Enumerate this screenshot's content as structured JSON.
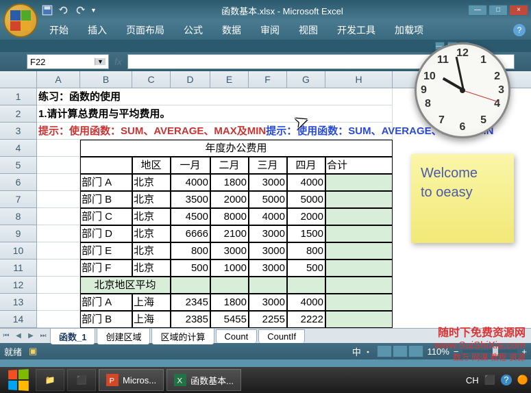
{
  "window": {
    "title": "函数基本.xlsx - Microsoft Excel",
    "controls": {
      "min": "—",
      "max": "□",
      "close": "×"
    }
  },
  "ribbon": {
    "tabs": [
      "开始",
      "插入",
      "页面布局",
      "公式",
      "数据",
      "审阅",
      "视图",
      "开发工具",
      "加载项"
    ],
    "help": "?"
  },
  "name_box": {
    "value": "F22",
    "fx": "fx"
  },
  "columns": [
    "A",
    "B",
    "C",
    "D",
    "E",
    "F",
    "G",
    "H"
  ],
  "rows": {
    "1": {
      "A": "练习：函数的使用"
    },
    "2": {
      "A": "1.请计算总费用与平均费用。"
    },
    "3": {
      "A": "提示：使用函数：SUM、AVERAGE、MAX及MIN"
    },
    "4": {
      "merged": "年度办公费用"
    },
    "5": {
      "C": "地区",
      "D": "一月",
      "E": "二月",
      "F": "三月",
      "G": "四月",
      "H": "合计"
    },
    "6": {
      "B": "部门 A",
      "C": "北京",
      "D": "4000",
      "E": "1800",
      "F": "3000",
      "G": "4000"
    },
    "7": {
      "B": "部门 B",
      "C": "北京",
      "D": "3500",
      "E": "2000",
      "F": "5000",
      "G": "5000"
    },
    "8": {
      "B": "部门 C",
      "C": "北京",
      "D": "4500",
      "E": "8000",
      "F": "4000",
      "G": "2000"
    },
    "9": {
      "B": "部门 D",
      "C": "北京",
      "D": "6666",
      "E": "2100",
      "F": "3000",
      "G": "1500"
    },
    "10": {
      "B": "部门 E",
      "C": "北京",
      "D": "800",
      "E": "3000",
      "F": "3000",
      "G": "800"
    },
    "11": {
      "B": "部门 F",
      "C": "北京",
      "D": "500",
      "E": "1000",
      "F": "3000",
      "G": "500"
    },
    "12": {
      "B": "北京地区平均"
    },
    "13": {
      "B": "部门 A",
      "C": "上海",
      "D": "2345",
      "E": "1800",
      "F": "3000",
      "G": "4000"
    },
    "14": {
      "B": "部门 B",
      "C": "上海",
      "D": "2385",
      "E": "5455",
      "F": "2255",
      "G": "2222"
    }
  },
  "sheet_tabs": [
    "函数_1",
    "创建区域",
    "区域的计算",
    "Count",
    "CountIf"
  ],
  "status": {
    "ready": "就绪",
    "zoom": "110%",
    "ime": "中  ・"
  },
  "sticky": {
    "line1": "Welcome",
    "line2": "to oeasy"
  },
  "clock_numbers": [
    "12",
    "1",
    "2",
    "3",
    "4",
    "5",
    "6",
    "7",
    "8",
    "9",
    "10",
    "11"
  ],
  "watermark": {
    "l1": "随时下免费资源网",
    "l2": "www.SuiShiXia.com",
    "l3": "数万 网课 教程 资源"
  },
  "taskbar": {
    "items": [
      {
        "icon": "ppt",
        "label": "Micros..."
      },
      {
        "icon": "excel",
        "label": "函数基本..."
      }
    ],
    "ime": "CH",
    "help": "?"
  }
}
